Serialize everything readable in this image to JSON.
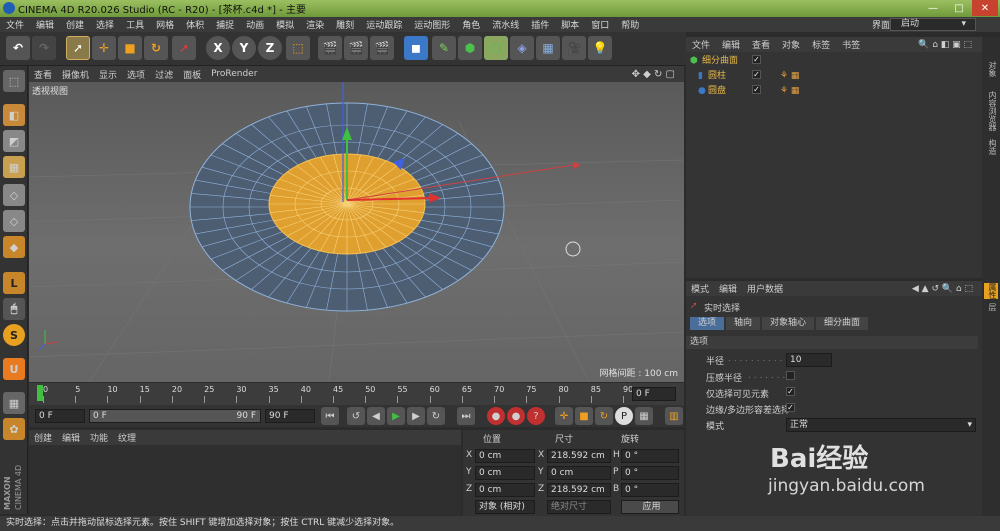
{
  "window": {
    "title": "CINEMA 4D R20.026 Studio (RC - R20) - [茶杯.c4d *] - 主要"
  },
  "menubar": [
    "文件",
    "编辑",
    "创建",
    "选择",
    "工具",
    "网格",
    "体积",
    "捕捉",
    "动画",
    "模拟",
    "渲染",
    "雕刻",
    "运动跟踪",
    "运动图形",
    "角色",
    "流水线",
    "插件",
    "脚本",
    "窗口",
    "帮助"
  ],
  "layout": {
    "label": "界面:",
    "value": "启动"
  },
  "toolbar": {
    "x": "X",
    "y": "Y",
    "z": "Z"
  },
  "viewport": {
    "menu": [
      "查看",
      "摄像机",
      "显示",
      "选项",
      "过滤",
      "面板",
      "ProRender"
    ],
    "label": "透视视图",
    "grid_info": "网格间距 : 100 cm"
  },
  "timeline": {
    "ticks": [
      "0",
      "5",
      "10",
      "15",
      "20",
      "25",
      "30",
      "35",
      "40",
      "45",
      "50",
      "55",
      "60",
      "65",
      "70",
      "75",
      "80",
      "85",
      "90"
    ],
    "current": "0 F"
  },
  "playbar": {
    "start": "0 F",
    "range_start": "0 F",
    "range_end": "90 F",
    "end": "90 F"
  },
  "material_manager": {
    "menu": [
      "创建",
      "编辑",
      "功能",
      "纹理"
    ]
  },
  "coords": {
    "headers": [
      "位置",
      "尺寸",
      "旋转"
    ],
    "rows": [
      {
        "axis": "X",
        "pos": "0 cm",
        "saxis": "X",
        "size": "218.592 cm",
        "raxis": "H",
        "rot": "0 °"
      },
      {
        "axis": "Y",
        "pos": "0 cm",
        "saxis": "Y",
        "size": "0 cm",
        "raxis": "P",
        "rot": "0 °"
      },
      {
        "axis": "Z",
        "pos": "0 cm",
        "saxis": "Z",
        "size": "218.592 cm",
        "raxis": "B",
        "rot": "0 °"
      }
    ],
    "mode": "对象 (相对)",
    "size_mode": "绝对尺寸",
    "apply": "应用"
  },
  "object_manager": {
    "menu": [
      "文件",
      "编辑",
      "查看",
      "对象",
      "标签",
      "书签"
    ],
    "objects": [
      {
        "name": "细分曲面",
        "color": "#e8b84a"
      },
      {
        "name": "圆柱",
        "color": "#e8b84a"
      },
      {
        "name": "圆盘",
        "color": "#e8b84a"
      }
    ]
  },
  "attribute_manager": {
    "menu": [
      "模式",
      "编辑",
      "用户数据"
    ],
    "tool_name": "实时选择",
    "tabs": [
      "选项",
      "轴向",
      "对象轴心",
      "细分曲面"
    ],
    "section": "选项",
    "fields": {
      "radius_label": "半径",
      "radius_value": "10",
      "pressure_label": "压感半径",
      "visible_label": "仅选择可见元素",
      "edge_label": "边缘/多边形容差选择",
      "mode_label": "模式",
      "mode_value": "正常"
    }
  },
  "right_tabs": [
    "对象",
    "内容浏览器",
    "构造",
    "属性",
    "层"
  ],
  "brand": {
    "maxon": "MAXON",
    "c4d": "CINEMA 4D"
  },
  "watermark": {
    "text": "Bai经验",
    "url": "jingyan.baidu.com"
  },
  "status": "实时选择：点击并拖动鼠标选择元素。按住 SHIFT 键增加选择对象；按住 CTRL 键减少选择对象。"
}
